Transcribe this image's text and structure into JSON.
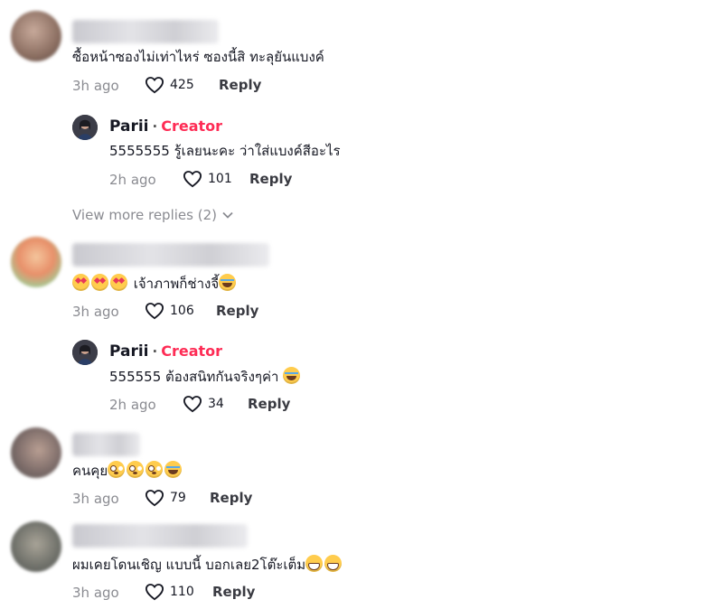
{
  "comments": [
    {
      "text": "ซื้อหน้าซองไม่เท่าไหร่ ซองนี้สิ ทะลุยันแบงค์",
      "time": "3h ago",
      "likes": "425",
      "reply_label": "Reply",
      "creator_reply": {
        "name": "Parii",
        "tag": "Creator",
        "text": "5555555 รู้เลยนะคะ ว่าใส่แบงค์สีอะไร",
        "time": "2h ago",
        "likes": "101",
        "reply_label": "Reply"
      },
      "view_more": "View more replies (2)"
    },
    {
      "text": " เจ้าภาพก็ช่างจี้",
      "time": "3h ago",
      "likes": "106",
      "reply_label": "Reply",
      "creator_reply": {
        "name": "Parii",
        "tag": "Creator",
        "text": "555555 ต้องสนิทกันจริงๆค่า ",
        "time": "2h ago",
        "likes": "34",
        "reply_label": "Reply"
      }
    },
    {
      "text": "คนคุย",
      "time": "3h ago",
      "likes": "79",
      "reply_label": "Reply"
    },
    {
      "text": "ผมเคยโดนเชิญ แบบนี้ บอกเลย2โต๊ะเต็ม",
      "time": "3h ago",
      "likes": "110",
      "reply_label": "Reply"
    }
  ],
  "separator": "·",
  "colors": {
    "creator": "#fe2c55",
    "muted": "#8a8b91",
    "text": "#161823"
  },
  "icons": {
    "like": "heart-outline-icon",
    "expand": "chevron-down-icon"
  }
}
